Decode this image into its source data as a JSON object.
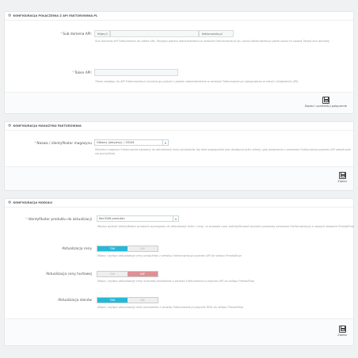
{
  "api_panel": {
    "title": "KONFIGURACJA POŁĄCZENIA Z API FAKTUROWNIA.PL",
    "domain_label": "Sub domena API:",
    "domain_prefix": "https://",
    "domain_suffix": "fakturownia.pl",
    "domain_value": "",
    "domain_help": "Sub domena API Fakturownia (to adres URL Twojego panelu administratora w serwisie Fakturownia.pl np. xxxxx.fakturownia.pl gdzie xxxxx to nazwa Twojej sub domeny",
    "token_label": "Token API:",
    "token_value": "",
    "token_help": "Token dostępu do API Fakturownia.pl (można go pobrać z panelu administratora w serwisie Fakturownia po zalogowaniu w sekcji: Ustawienia\\ API)",
    "save_label": "Zapisz i przetestuj połączenie"
  },
  "warehouse_panel": {
    "title": "KONFIGURACJA MAGAZYNU FAKTUROWNIA",
    "warehouse_label": "Nazwa / identyfikator magazynu",
    "warehouse_value": "Główny (aktywny) / 13043",
    "warehouse_help": "Wybierz magazyn Fakturownia używany do aktualizacji ilości produktów (tą listę magazynów jest dostępna tylko wtedy, gdy połączenie z serwisem Fakturownia poprzez API zakończyło się pomyślnie)",
    "save_label": "Zapisz"
  },
  "module_panel": {
    "title": "KONFIGURACJA MODUŁU",
    "product_id_label": "Identyfikator produktu do aktualizacji",
    "product_id_value": "Kod EAN produktu",
    "product_id_help": "Musisz wybrać identyfikator produktu wymagany do aktualizacji ilości i ceny, co pozwala nam zidentyfikować produkt pomiędzy serwisem Fakturownia.pl a naszym sklepem PrestaShop",
    "price_label": "Aktualizacja ceny",
    "price_help": "Włącz / wyłącz aktualizację ceny produktów z serwisu Fakturownia.pl poprzez API do sklepu PrestaShop",
    "wholesale_label": "Aktualizacja ceny hurtowej",
    "wholesale_help": "Włącz / wyłącz aktualizację ceny hurtowej produktów z serwisu Fakturownia.pl poprzez API do sklepu PrestaShop",
    "stock_label": "Aktualizacja stanów",
    "stock_help": "Włącz / wyłącz aktualizację ilości produktów z serwisu Fakturownia.pl poprzez RPai do sklepu PrestaShop",
    "yes_label": "TAK",
    "no_label": "NIE",
    "save_label": "Zapisz"
  }
}
